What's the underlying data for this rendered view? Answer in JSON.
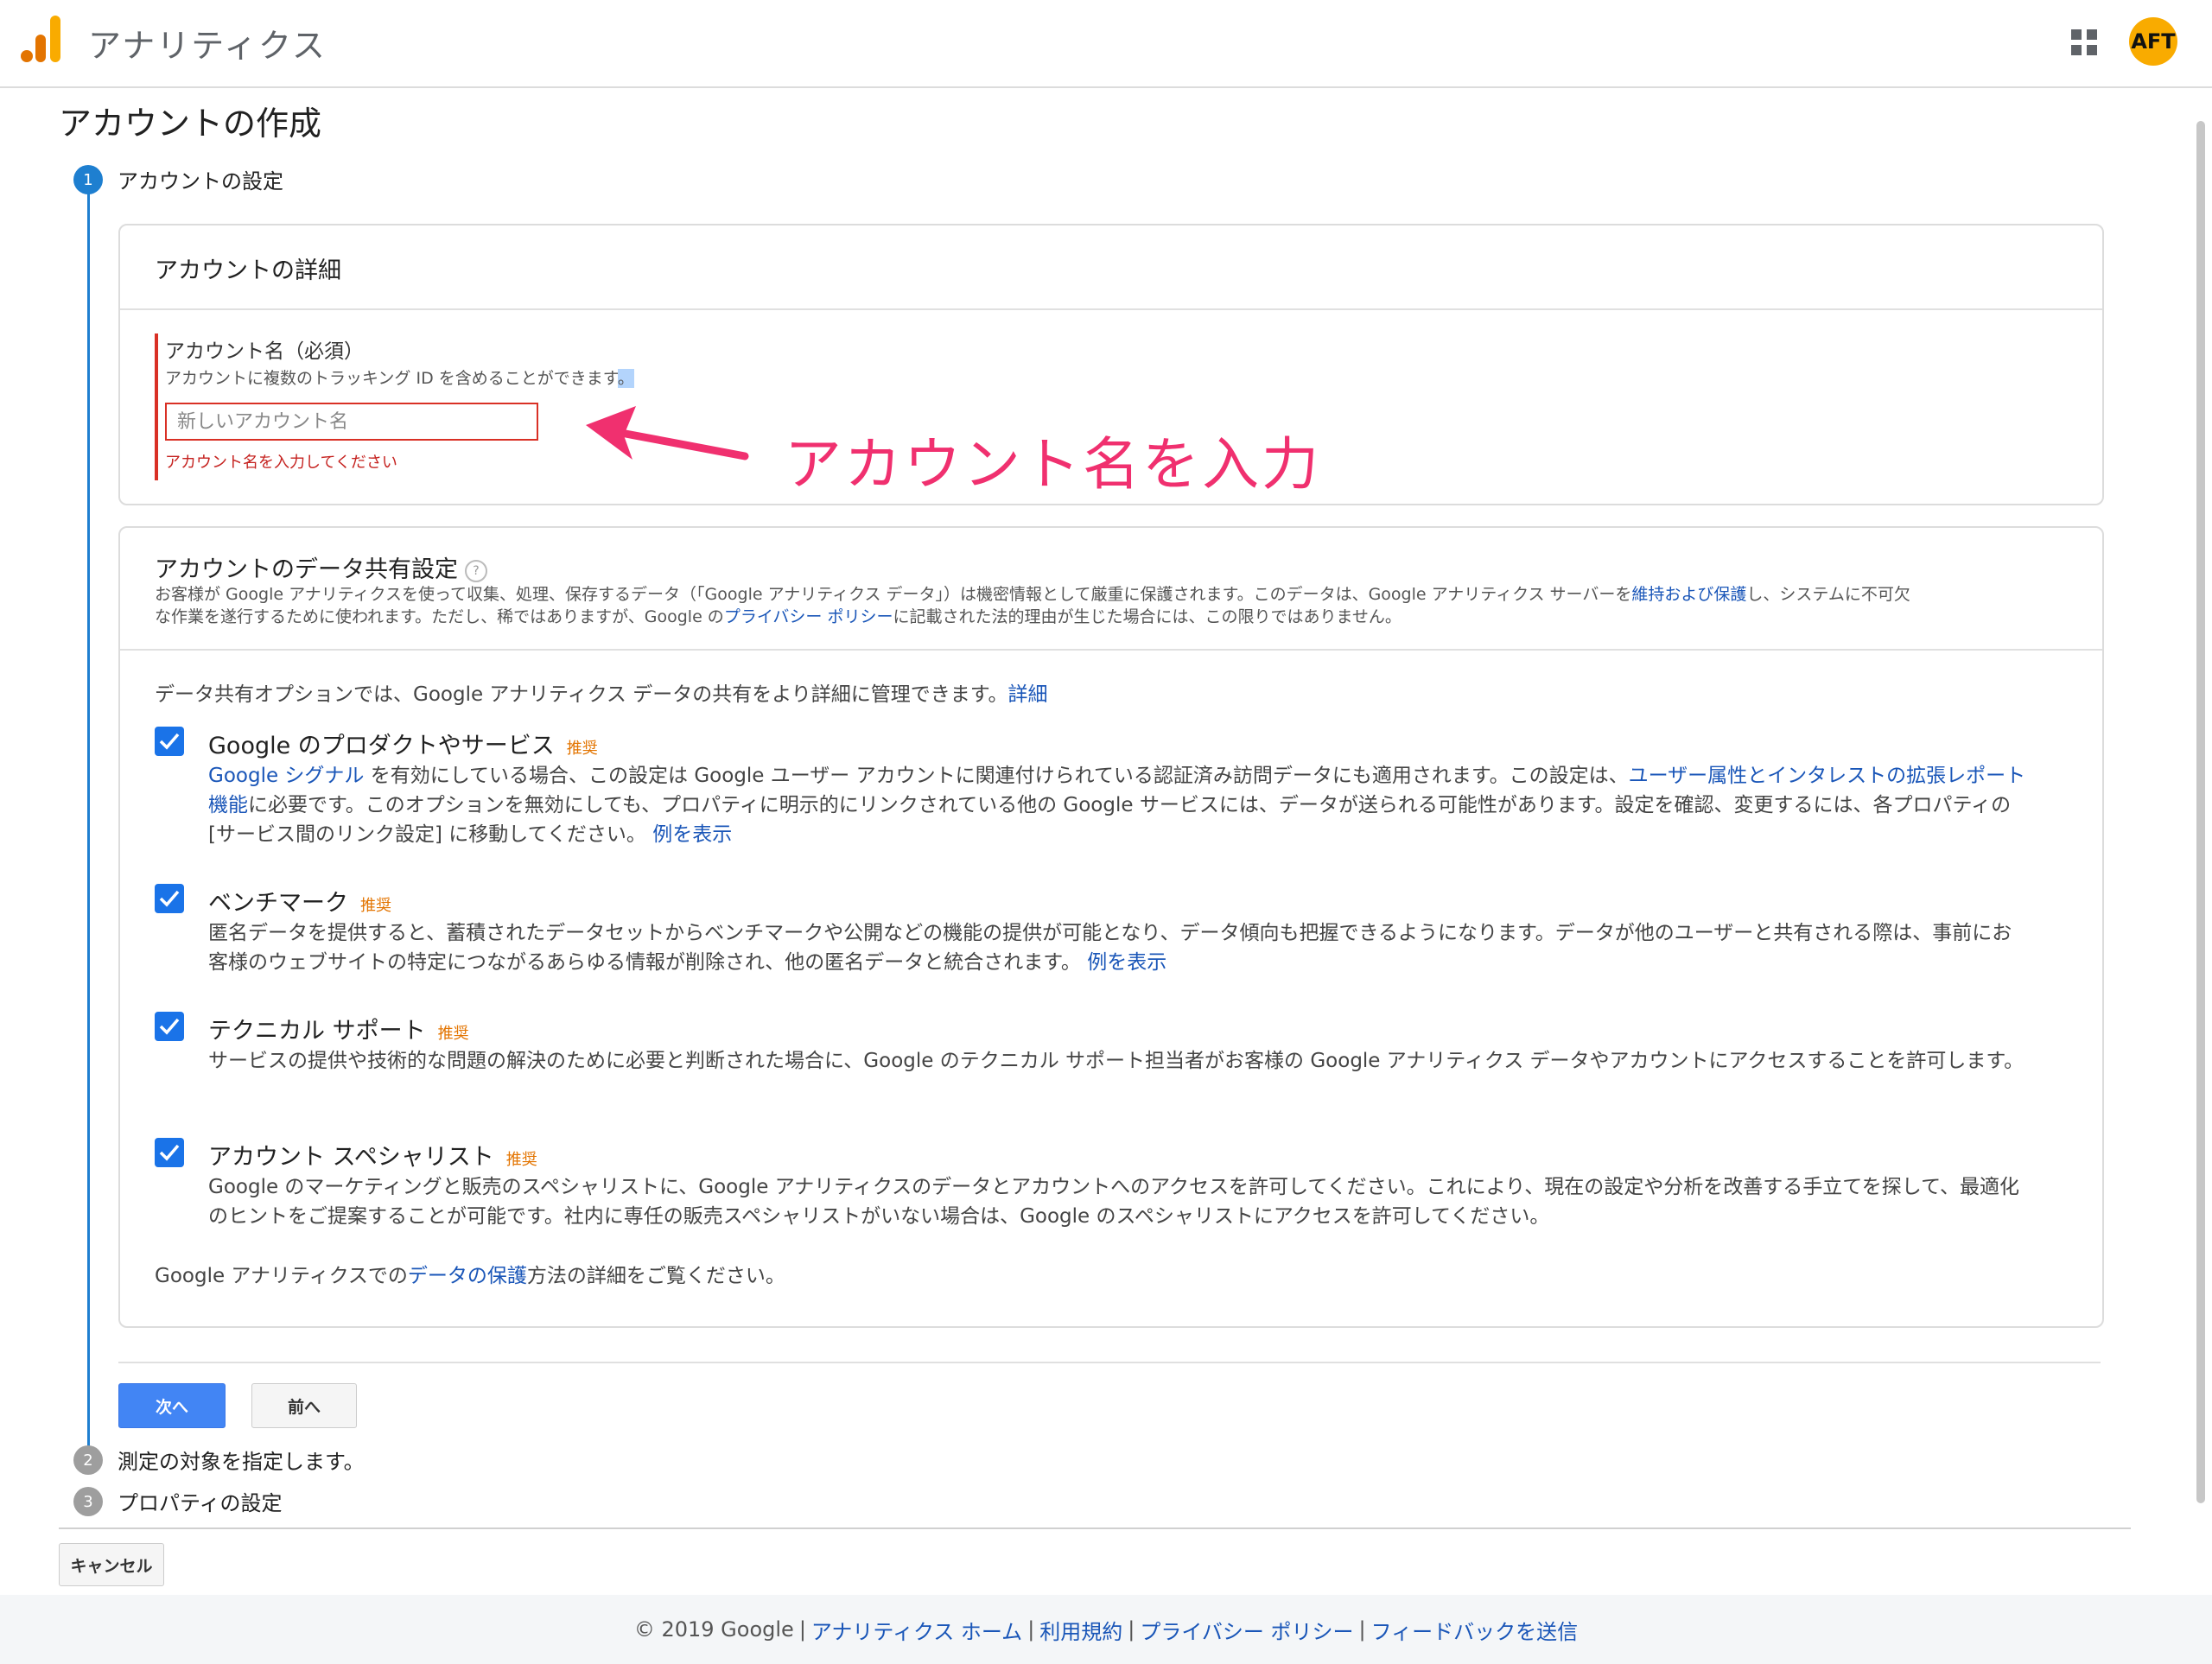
{
  "header": {
    "app_title": "アナリティクス",
    "avatar_text": "AFT"
  },
  "page": {
    "title": "アカウントの作成"
  },
  "steps": [
    {
      "number": "1",
      "label": "アカウントの設定"
    },
    {
      "number": "2",
      "label": "測定の対象を指定します。"
    },
    {
      "number": "3",
      "label": "プロパティの設定"
    }
  ],
  "account_details": {
    "heading": "アカウントの詳細",
    "name_label": "アカウント名（必須）",
    "name_help": "アカウントに複数のトラッキング ID を含めることができます",
    "name_help_tail": "。",
    "name_placeholder": "新しいアカウント名",
    "name_value": "",
    "name_error": "アカウント名を入力してください"
  },
  "annotation": {
    "text": "アカウント名を入力",
    "color": "#f0306f"
  },
  "data_sharing": {
    "heading": "アカウントのデータ共有設定",
    "help_glyph": "?",
    "desc_line1_a": "お客様が Google アナリティクスを使って収集、処理、保存するデータ（「Google アナリティクス データ」）は機密情報として厳重に保護されます。このデータは、Google アナリティクス サーバーを",
    "desc_line1_link": "維持および保護",
    "desc_line1_b": "し、システムに不可欠",
    "desc_line2_a": "な作業を遂行するために使われます。ただし、稀ではありますが、Google の",
    "desc_line2_link": "プライバシー ポリシー",
    "desc_line2_b": "に記載された法的理由が生じた場合には、この限りではありません。",
    "intro_text": "データ共有オプションでは、Google アナリティクス データの共有をより詳細に管理できます。",
    "intro_link": "詳細",
    "recommended": "推奨",
    "options": [
      {
        "title": "Google のプロダクトやサービス",
        "link_a": "Google シグナル",
        "text_a": " を有効にしている場合、この設定は Google ユーザー アカウントに関連付けられている認証済み訪問データにも適用されます。この設定は、",
        "link_b": "ユーザー属性とインタレストの拡張レポート機能",
        "text_b": "に必要です。このオプションを無効にしても、プロパティに明示的にリンクされている他の Google サービスには、データが送られる可能性があります。設定を確認、変更するには、各プロパティの [サービス間のリンク設定] に移動してください。 ",
        "example_link": "例を表示"
      },
      {
        "title": "ベンチマーク",
        "text": "匿名データを提供すると、蓄積されたデータセットからベンチマークや公開などの機能の提供が可能となり、データ傾向も把握できるようになります。データが他のユーザーと共有される際は、事前にお客様のウェブサイトの特定につながるあらゆる情報が削除され、他の匿名データと統合されます。 ",
        "example_link": "例を表示"
      },
      {
        "title": "テクニカル サポート",
        "text": "サービスの提供や技術的な問題の解決のために必要と判断された場合に、Google のテクニカル サポート担当者がお客様の Google アナリティクス データやアカウントにアクセスすることを許可します。"
      },
      {
        "title": "アカウント スペシャリスト",
        "text": "Google のマーケティングと販売のスペシャリストに、Google アナリティクスのデータとアカウントへのアクセスを許可してください。これにより、現在の設定や分析を改善する手立てを探して、最適化のヒントをご提案することが可能です。社内に専任の販売スペシャリストがいない場合は、Google のスペシャリストにアクセスを許可してください。"
      }
    ],
    "footer_a": "Google アナリティクスでの",
    "footer_link": "データの保護",
    "footer_b": "方法の詳細をご覧ください。"
  },
  "buttons": {
    "next": "次へ",
    "prev": "前へ",
    "cancel": "キャンセル"
  },
  "footer": {
    "copyright": "© 2019 Google",
    "separator": "|",
    "links": [
      "アナリティクス ホーム",
      "利用規約",
      "プライバシー ポリシー",
      "フィードバックを送信"
    ]
  },
  "colors": {
    "accent": "#1a73e8",
    "error": "#d93025",
    "link": "#1a56b8",
    "recommended": "#e37400"
  }
}
